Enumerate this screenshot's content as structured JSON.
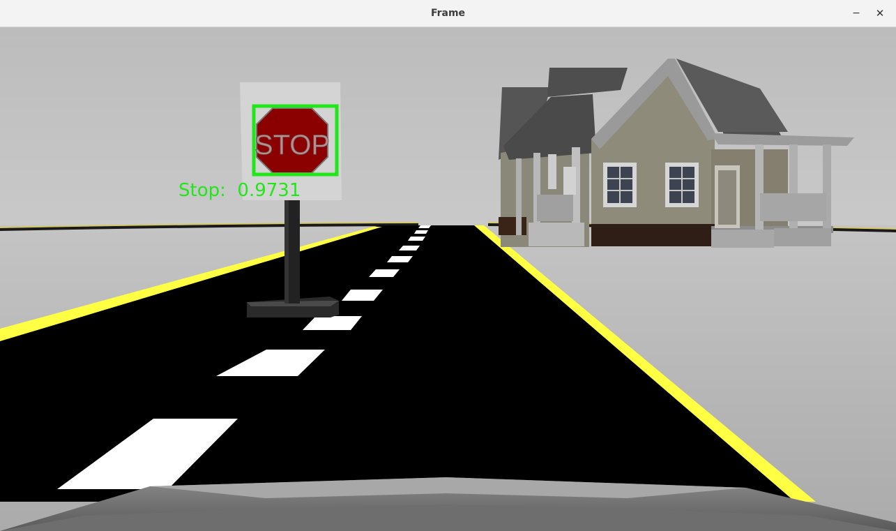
{
  "window": {
    "title": "Frame",
    "minimize_glyph": "−",
    "close_glyph": "✕"
  },
  "scene": {
    "sign_text": "STOP",
    "detection": {
      "label": "Stop",
      "confidence": "0.9731",
      "display": "Stop:  0.9731",
      "box_color": "#22e61a"
    },
    "colors": {
      "sky": "#b8b8b8",
      "ground": "#b5b5b5",
      "road": "#000000",
      "edge_line": "#ffff44",
      "lane_dash": "#ffffff",
      "sign_red": "#8b0000"
    }
  }
}
